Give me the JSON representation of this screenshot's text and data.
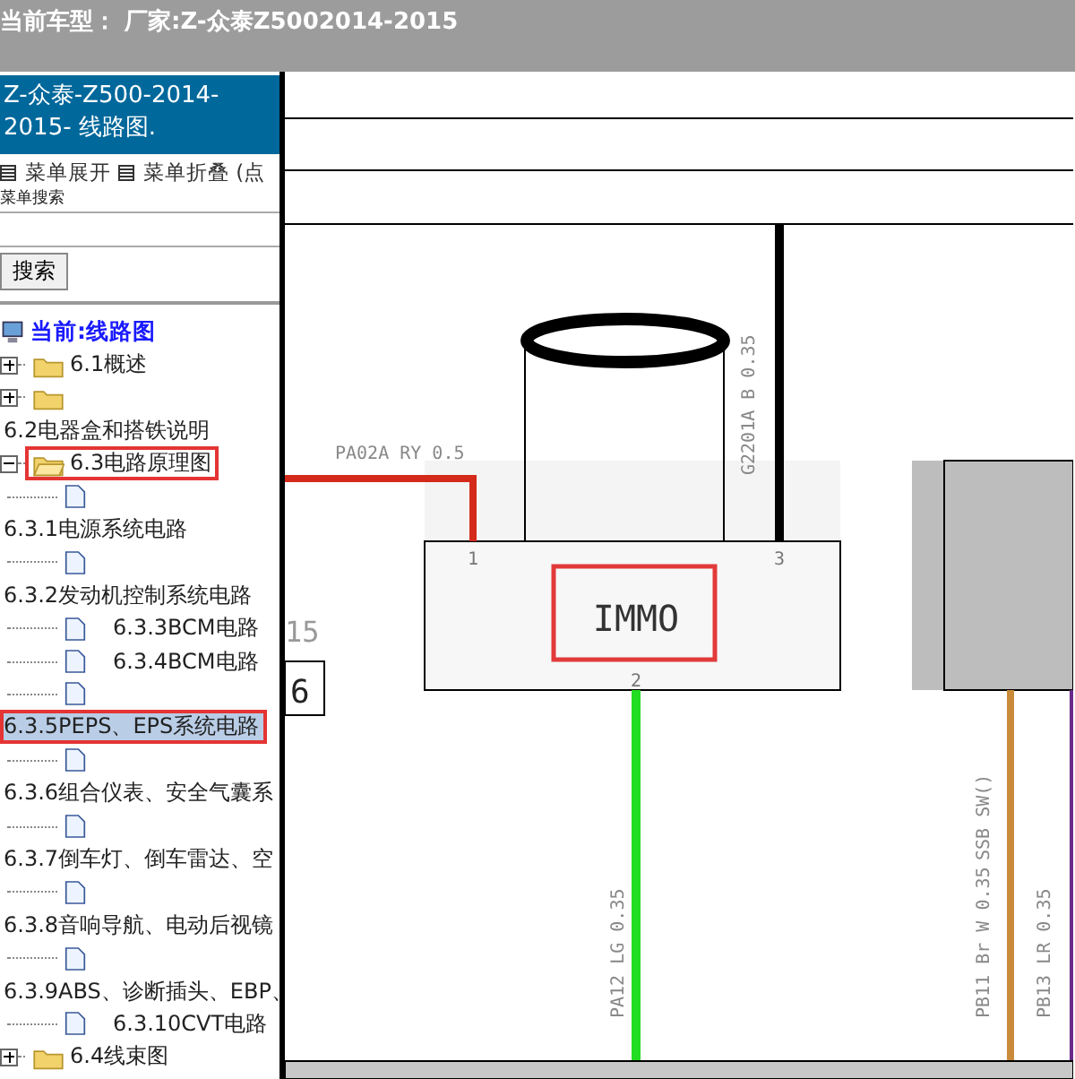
{
  "window": {
    "title": "当前车型： 厂家:Z-众泰Z5002014-2015"
  },
  "sidebar": {
    "header": "Z-众泰-Z500-2014-2015- 线路图.",
    "menu_actions": [
      {
        "label": "菜单展开"
      },
      {
        "label": "菜单折叠 (点"
      }
    ],
    "search": {
      "label": "菜单搜索",
      "button": "搜索"
    },
    "tree": {
      "label": "当前:线路图",
      "children": [
        {
          "kind": "folder",
          "label": "6.1概述",
          "expanded": false,
          "selected": false,
          "marked": false
        },
        {
          "kind": "folder",
          "expanded": false,
          "selected": false,
          "marked": false
        },
        {
          "kind": "text",
          "label": "6.2电器盒和搭铁说明",
          "selected": false,
          "marked": false
        },
        {
          "kind": "folder",
          "label": "6.3电路原理图",
          "expanded": true,
          "selected": false,
          "marked": true,
          "children": [
            {
              "kind": "page",
              "selected": false,
              "marked": false
            },
            {
              "kind": "text",
              "label": "6.3.1电源系统电路",
              "selected": false,
              "marked": false
            },
            {
              "kind": "page",
              "selected": false,
              "marked": false
            },
            {
              "kind": "text",
              "label": "6.3.2发动机控制系统电路",
              "selected": false,
              "marked": false
            },
            {
              "kind": "page",
              "label": "6.3.3BCM电路",
              "selected": false,
              "marked": false
            },
            {
              "kind": "page",
              "label": "6.3.4BCM电路",
              "selected": false,
              "marked": false
            },
            {
              "kind": "page",
              "selected": false,
              "marked": false
            },
            {
              "kind": "text",
              "label": "6.3.5PEPS、EPS系统电路",
              "selected": true,
              "marked": true
            },
            {
              "kind": "page",
              "selected": false,
              "marked": false
            },
            {
              "kind": "text",
              "label": "6.3.6组合仪表、安全气囊系",
              "selected": false,
              "marked": false
            },
            {
              "kind": "page",
              "selected": false,
              "marked": false
            },
            {
              "kind": "text",
              "label": "6.3.7倒车灯、倒车雷达、空",
              "selected": false,
              "marked": false
            },
            {
              "kind": "page",
              "selected": false,
              "marked": false
            },
            {
              "kind": "text",
              "label": "6.3.8音响导航、电动后视镜",
              "selected": false,
              "marked": false
            },
            {
              "kind": "page",
              "selected": false,
              "marked": false
            },
            {
              "kind": "text",
              "label": "6.3.9ABS、诊断插头、EBP、",
              "selected": false,
              "marked": false
            },
            {
              "kind": "page",
              "label": "6.3.10CVT电路",
              "selected": false,
              "marked": false
            }
          ]
        },
        {
          "kind": "folder",
          "label": "6.4线束图",
          "expanded": false,
          "selected": false,
          "marked": false
        }
      ]
    }
  },
  "diagram": {
    "module": {
      "label": "IMMO",
      "marked": true,
      "pins": [
        "1",
        "3",
        "2"
      ]
    },
    "wires": [
      {
        "label": "PA02A RY 0.5"
      },
      {
        "label": "G2201A B 0.35"
      },
      {
        "label": "PA12 LG 0.35"
      },
      {
        "label": "PB11 Br W 0.35"
      },
      {
        "label": "SSB SW()"
      },
      {
        "label": "PB13 LR 0.35"
      }
    ],
    "side_labels": [
      "15",
      "6"
    ]
  }
}
